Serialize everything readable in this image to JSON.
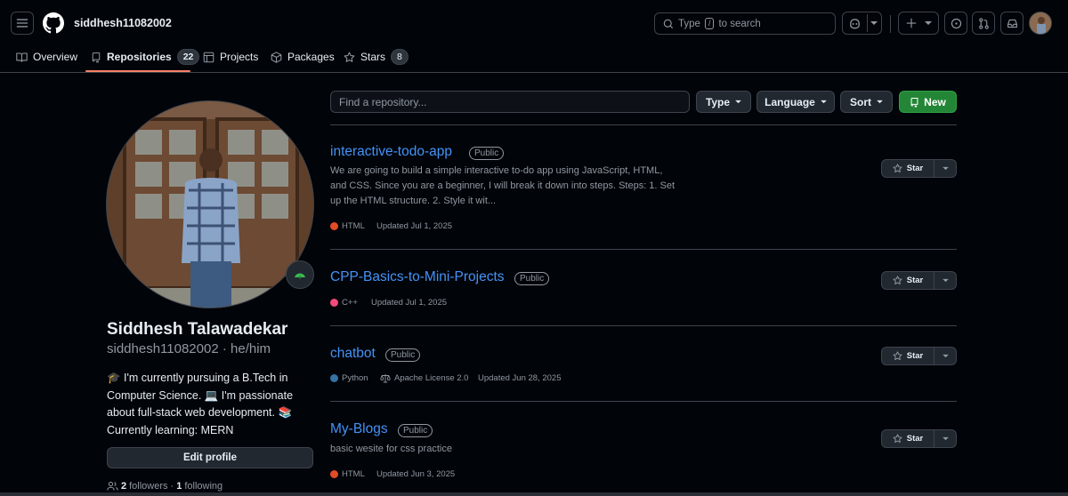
{
  "header": {
    "username": "siddhesh11082002",
    "search_placeholder_before": "Type",
    "search_key": "/",
    "search_placeholder_after": "to search"
  },
  "tabs": [
    {
      "label": "Overview"
    },
    {
      "label": "Repositories",
      "count": "22"
    },
    {
      "label": "Projects"
    },
    {
      "label": "Packages"
    },
    {
      "label": "Stars",
      "count": "8"
    }
  ],
  "filters": {
    "search_placeholder": "Find a repository...",
    "type_label": "Type",
    "language_label": "Language",
    "sort_label": "Sort",
    "new_label": "New"
  },
  "profile": {
    "full_name": "Siddhesh Talawadekar",
    "login": "siddhesh11082002",
    "pronouns": "he/him",
    "bio": "🎓 I'm currently pursuing a B.Tech in Computer Science. 💻 I'm passionate about full-stack web development. 📚 Currently learning: MERN",
    "edit_label": "Edit profile",
    "followers_count": "2",
    "followers_label": "followers",
    "following_count": "1",
    "following_label": "following"
  },
  "repos": [
    {
      "name": "interactive-todo-app",
      "visibility": "Public",
      "description": "We are going to build a simple interactive to-do app using JavaScript, HTML, and CSS. Since you are a beginner, I will break it down into steps. Steps: 1. Set up the HTML structure. 2. Style it wit...",
      "language": "HTML",
      "language_color": "#e34c26",
      "updated": "Updated Jul 1, 2025",
      "star_label": "Star"
    },
    {
      "name": "CPP-Basics-to-Mini-Projects",
      "visibility": "Public",
      "description": "",
      "language": "C++",
      "language_color": "#f34b7d",
      "updated": "Updated Jul 1, 2025",
      "star_label": "Star"
    },
    {
      "name": "chatbot",
      "visibility": "Public",
      "description": "",
      "language": "Python",
      "language_color": "#3572A5",
      "license": "Apache License 2.0",
      "updated": "Updated Jun 28, 2025",
      "star_label": "Star"
    },
    {
      "name": "My-Blogs",
      "visibility": "Public",
      "description": "basic wesite for css practice",
      "language": "HTML",
      "language_color": "#e34c26",
      "updated": "Updated Jun 3, 2025",
      "star_label": "Star"
    }
  ],
  "colors": {
    "background": "#010409",
    "link": "#4493f8",
    "accent_underline": "#f78166",
    "new_button": "#238636"
  }
}
